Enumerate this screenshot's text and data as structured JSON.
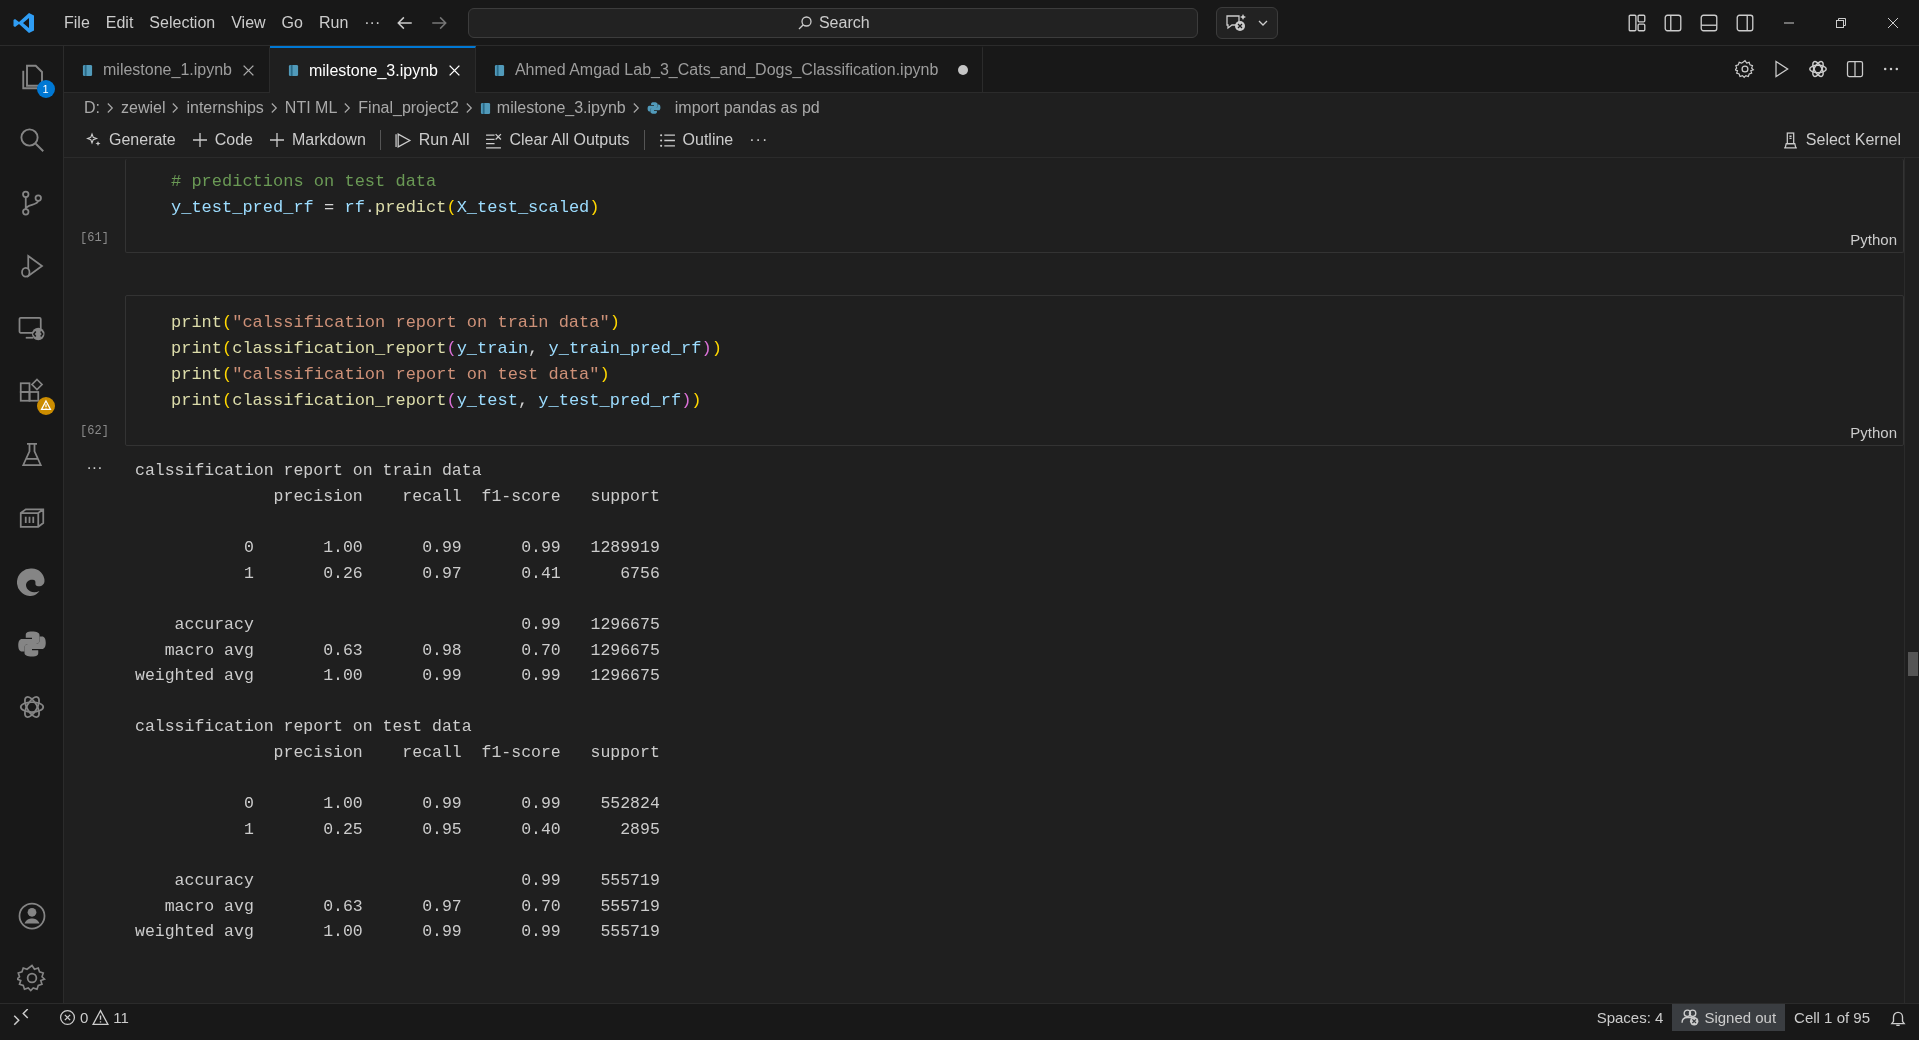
{
  "menu": [
    "File",
    "Edit",
    "Selection",
    "View",
    "Go",
    "Run",
    "···"
  ],
  "search": {
    "label": "Search"
  },
  "activity_bar": {
    "explorer_badge": "1"
  },
  "tabs": [
    {
      "label": "milestone_1.ipynb",
      "selected": false,
      "dirty": false
    },
    {
      "label": "milestone_3.ipynb",
      "selected": true,
      "dirty": false
    },
    {
      "label": "Ahmed Amgad Lab_3_Cats_and_Dogs_Classification.ipynb",
      "selected": false,
      "dirty": true
    }
  ],
  "breadcrumb": [
    {
      "label": "D:",
      "kind": "folder"
    },
    {
      "label": "zewiel",
      "kind": "folder"
    },
    {
      "label": "internships",
      "kind": "folder"
    },
    {
      "label": "NTI ML",
      "kind": "folder"
    },
    {
      "label": "Final_project2",
      "kind": "folder"
    },
    {
      "label": "milestone_3.ipynb",
      "kind": "notebook"
    },
    {
      "label": "import pandas as pd",
      "kind": "python"
    }
  ],
  "toolbar": [
    {
      "label": "Generate",
      "kind": "sparkle"
    },
    {
      "label": "Code",
      "kind": "plus"
    },
    {
      "label": "Markdown",
      "kind": "plus"
    },
    {
      "label": "Run All",
      "kind": "run",
      "divider": true
    },
    {
      "label": "Clear All Outputs",
      "kind": "clear"
    },
    {
      "label": "Outline",
      "kind": "list",
      "divider": true
    }
  ],
  "toolbar_more": "···",
  "kernel": "Select Kernel",
  "cells": [
    {
      "count": "[61]",
      "language": "Python",
      "lines": [
        [
          {
            "kind": "comment",
            "text": "# predictions on test data"
          }
        ],
        [
          {
            "kind": "variable",
            "text": "y_test_pred_rf"
          },
          {
            "kind": "plain",
            "text": " = "
          },
          {
            "kind": "variable",
            "text": "rf"
          },
          {
            "kind": "plain",
            "text": "."
          },
          {
            "kind": "function",
            "text": "predict"
          },
          {
            "kind": "paren1",
            "text": "("
          },
          {
            "kind": "variable",
            "text": "X_test_scaled"
          },
          {
            "kind": "paren1",
            "text": ")"
          }
        ]
      ]
    },
    {
      "count": "[62]",
      "language": "Python",
      "lines": [
        [
          {
            "kind": "function",
            "text": "print"
          },
          {
            "kind": "paren1",
            "text": "("
          },
          {
            "kind": "string",
            "text": "\"calssification report on train data\""
          },
          {
            "kind": "paren1",
            "text": ")"
          }
        ],
        [
          {
            "kind": "function",
            "text": "print"
          },
          {
            "kind": "paren1",
            "text": "("
          },
          {
            "kind": "function",
            "text": "classification_report"
          },
          {
            "kind": "paren2",
            "text": "("
          },
          {
            "kind": "variable",
            "text": "y_train"
          },
          {
            "kind": "plain",
            "text": ", "
          },
          {
            "kind": "variable",
            "text": "y_train_pred_rf"
          },
          {
            "kind": "paren2",
            "text": ")"
          },
          {
            "kind": "paren1",
            "text": ")"
          }
        ],
        [
          {
            "kind": "function",
            "text": "print"
          },
          {
            "kind": "paren1",
            "text": "("
          },
          {
            "kind": "string",
            "text": "\"calssification report on test data\""
          },
          {
            "kind": "paren1",
            "text": ")"
          }
        ],
        [
          {
            "kind": "function",
            "text": "print"
          },
          {
            "kind": "paren1",
            "text": "("
          },
          {
            "kind": "function",
            "text": "classification_report"
          },
          {
            "kind": "paren2",
            "text": "("
          },
          {
            "kind": "variable",
            "text": "y_test"
          },
          {
            "kind": "plain",
            "text": ", "
          },
          {
            "kind": "variable",
            "text": "y_test_pred_rf"
          },
          {
            "kind": "paren2",
            "text": ")"
          },
          {
            "kind": "paren1",
            "text": ")"
          }
        ]
      ]
    }
  ],
  "output": {
    "more": "···",
    "sections": [
      [
        "calssification report on train data",
        "              precision    recall  f1-score   support"
      ],
      [
        "           0       1.00      0.99      0.99   1289919",
        "           1       0.26      0.97      0.41      6756"
      ],
      [
        "    accuracy                           0.99   1296675",
        "   macro avg       0.63      0.98      0.70   1296675",
        "weighted avg       1.00      0.99      0.99   1296675"
      ],
      [
        "calssification report on test data",
        "              precision    recall  f1-score   support"
      ],
      [
        "           0       1.00      0.99      0.99    552824",
        "           1       0.25      0.95      0.40      2895"
      ],
      [
        "    accuracy                           0.99    555719",
        "   macro avg       0.63      0.97      0.70    555719",
        "weighted avg       1.00      0.99      0.99    555719"
      ]
    ]
  },
  "status_bar": {
    "errors": "0",
    "warnings": "11",
    "spaces": "Spaces: 4",
    "account": "Signed out",
    "cell": "Cell 1 of 95"
  }
}
